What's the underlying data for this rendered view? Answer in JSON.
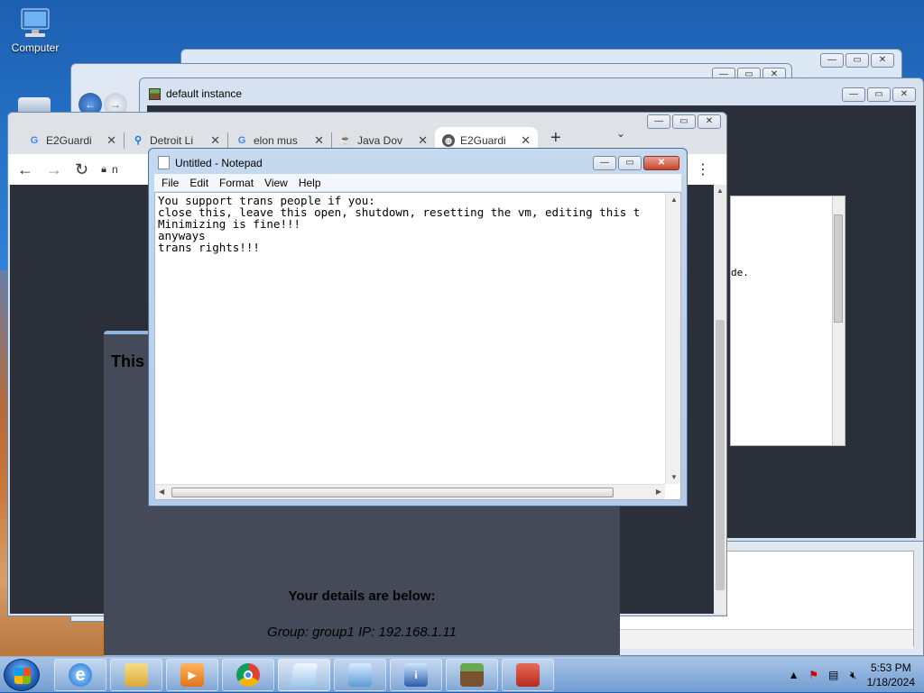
{
  "desktop": {
    "icons": [
      {
        "label": "Computer"
      }
    ]
  },
  "minecraft_window": {
    "title": "default instance",
    "panel_fragment": "de."
  },
  "chrome": {
    "tabs": [
      {
        "label": "E2Guardi",
        "icon": "google-icon",
        "active": false
      },
      {
        "label": "Detroit Li",
        "icon": "search-icon",
        "active": false
      },
      {
        "label": "elon mus",
        "icon": "google-icon",
        "active": false
      },
      {
        "label": "Java Dov",
        "icon": "java-icon",
        "active": false
      },
      {
        "label": "E2Guardi",
        "icon": "globe-icon",
        "active": true
      }
    ],
    "address": "n",
    "page": {
      "heading": "This",
      "details_heading": "Your details are below:",
      "group_ip": "Group: group1   IP: 192.168.1.11"
    }
  },
  "notepad": {
    "title": "Untitled - Notepad",
    "menu": [
      "File",
      "Edit",
      "Format",
      "View",
      "Help"
    ],
    "text": "You support trans people if you:\nclose this, leave this open, shutdown, resetting the vm, editing this t\nMinimizing is fine!!!\nanyways\ntrans rights!!!"
  },
  "taskbar": {
    "apps": [
      "internet-explorer",
      "file-explorer",
      "media-player",
      "chrome",
      "notepad",
      "control-panel",
      "info",
      "minecraft",
      "toolbox"
    ],
    "active_app": "notepad"
  },
  "clock": {
    "time": "5:53 PM",
    "date": "1/18/2024"
  },
  "colors": {
    "page_bg": "#2b2f3a",
    "card_bg": "#454a59",
    "card_border": "#8fb6e0"
  }
}
